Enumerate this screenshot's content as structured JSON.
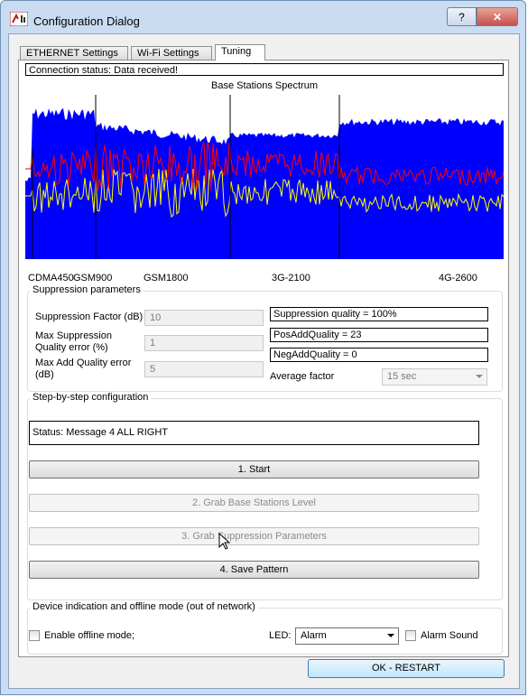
{
  "window": {
    "title": "Configuration Dialog",
    "help_label": "?",
    "close_label": "✕"
  },
  "tabs": [
    {
      "label": "ETHERNET Settings"
    },
    {
      "label": "Wi-Fi Settings"
    },
    {
      "label": "Tuning"
    }
  ],
  "active_tab": "Tuning",
  "connection_status": "Connection status: Data received!",
  "spectrum": {
    "title": "Base Stations Spectrum",
    "band_labels": [
      "CDMA450",
      "GSM900",
      "GSM1800",
      "3G-2100",
      "4G-2600"
    ],
    "colors": {
      "background": "#0000ff",
      "max_line": "#ff0000",
      "level_line": "#ffff00",
      "markers": "#000000"
    }
  },
  "suppression": {
    "group_label": "Suppression parameters",
    "factor_label": "Suppression Factor (dB)",
    "factor_value": "10",
    "max_quality_label_1": "Max Suppression",
    "max_quality_label_2": "Quality error (%)",
    "max_quality_value": "1",
    "max_add_label_1": "Max Add Quality error",
    "max_add_label_2": "(dB)",
    "max_add_value": "5",
    "quality": "Suppression quality = 100%",
    "pos_add": "PosAddQuality = 23",
    "neg_add": "NegAddQuality = 0",
    "average_label": "Average factor",
    "average_value": "15 sec"
  },
  "steps": {
    "group_label": "Step-by-step configuration",
    "status": "Status: Message 4 ALL RIGHT",
    "start": "1. Start",
    "grab_base": "2. Grab Base Stations Level",
    "grab_supp": "3. Grab Suppression Parameters",
    "save": "4. Save Pattern"
  },
  "device": {
    "group_label": "Device indication and offline mode (out of network)",
    "offline_label": "Enable offline mode;",
    "led_label": "LED:",
    "led_value": "Alarm",
    "alarm_sound_label": "Alarm Sound"
  },
  "ok_restart": "OK - RESTART"
}
